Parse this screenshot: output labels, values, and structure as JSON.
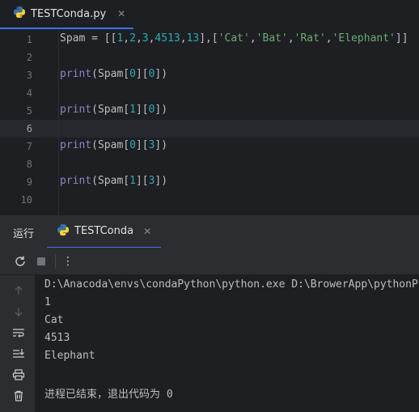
{
  "editor_tab": {
    "file_name": "TESTConda.py",
    "close_glyph": "✕"
  },
  "editor": {
    "line_numbers": [
      "1",
      "2",
      "3",
      "4",
      "5",
      "6",
      "7",
      "8",
      "9",
      "10"
    ],
    "current_line": 6,
    "lines": [
      [
        {
          "t": "Spam = [[",
          "c": "plain"
        },
        {
          "t": "1",
          "c": "num"
        },
        {
          "t": ",",
          "c": "plain"
        },
        {
          "t": "2",
          "c": "num"
        },
        {
          "t": ",",
          "c": "plain"
        },
        {
          "t": "3",
          "c": "num"
        },
        {
          "t": ",",
          "c": "plain"
        },
        {
          "t": "4513",
          "c": "num"
        },
        {
          "t": ",",
          "c": "plain"
        },
        {
          "t": "13",
          "c": "num"
        },
        {
          "t": "],[",
          "c": "plain"
        },
        {
          "t": "'Cat'",
          "c": "str"
        },
        {
          "t": ",",
          "c": "plain"
        },
        {
          "t": "'Bat'",
          "c": "str"
        },
        {
          "t": ",",
          "c": "plain"
        },
        {
          "t": "'Rat'",
          "c": "str"
        },
        {
          "t": ",",
          "c": "plain"
        },
        {
          "t": "'Elephant'",
          "c": "str"
        },
        {
          "t": "]]",
          "c": "plain"
        }
      ],
      [],
      [
        {
          "t": "print",
          "c": "kw-print"
        },
        {
          "t": "(Spam[",
          "c": "plain"
        },
        {
          "t": "0",
          "c": "num"
        },
        {
          "t": "][",
          "c": "plain"
        },
        {
          "t": "0",
          "c": "num"
        },
        {
          "t": "])",
          "c": "plain"
        }
      ],
      [],
      [
        {
          "t": "print",
          "c": "kw-print"
        },
        {
          "t": "(Spam[",
          "c": "plain"
        },
        {
          "t": "1",
          "c": "num"
        },
        {
          "t": "][",
          "c": "plain"
        },
        {
          "t": "0",
          "c": "num"
        },
        {
          "t": "])",
          "c": "plain"
        }
      ],
      [],
      [
        {
          "t": "print",
          "c": "kw-print"
        },
        {
          "t": "(Spam[",
          "c": "plain"
        },
        {
          "t": "0",
          "c": "num"
        },
        {
          "t": "][",
          "c": "plain"
        },
        {
          "t": "3",
          "c": "num"
        },
        {
          "t": "])",
          "c": "plain"
        }
      ],
      [],
      [
        {
          "t": "print",
          "c": "kw-print"
        },
        {
          "t": "(Spam[",
          "c": "plain"
        },
        {
          "t": "1",
          "c": "num"
        },
        {
          "t": "][",
          "c": "plain"
        },
        {
          "t": "3",
          "c": "num"
        },
        {
          "t": "])",
          "c": "plain"
        }
      ],
      []
    ]
  },
  "run_panel": {
    "title": "运行",
    "tab_name": "TESTConda",
    "close_glyph": "✕",
    "toolbar": {
      "rerun_icon": "rerun-icon",
      "stop_icon": "stop-icon",
      "more_icon": "more-vertical-icon",
      "more_glyph": "⋮"
    },
    "side_icons": [
      "arrow-up-icon",
      "arrow-down-icon",
      "soft-wrap-icon",
      "scroll-to-end-icon",
      "print-icon",
      "trash-icon"
    ],
    "console_lines": [
      "D:\\Anacoda\\envs\\condaPython\\python.exe D:\\BrowerApp\\pythonProject",
      "1",
      "Cat",
      "4513",
      "Elephant",
      "",
      "进程已结束，退出代码为 0"
    ]
  },
  "colors": {
    "accent": "#3574f0",
    "python_blue": "#3776ab",
    "python_yellow": "#ffd43b"
  }
}
